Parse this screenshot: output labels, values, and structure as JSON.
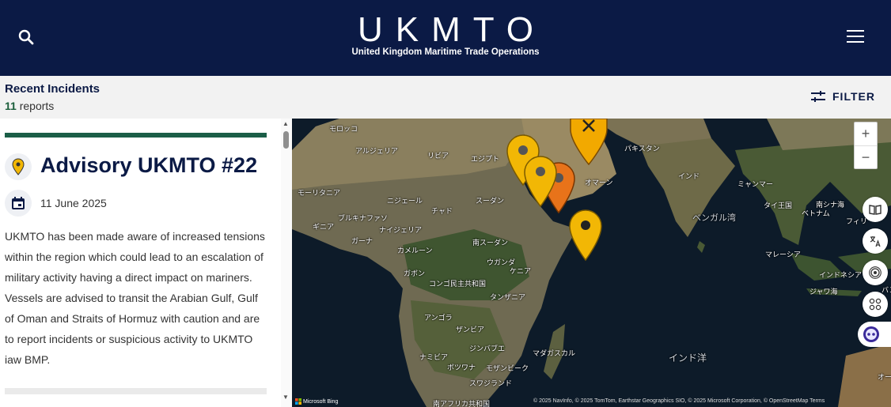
{
  "header": {
    "logo_title": "UKMTO",
    "logo_subtitle": "United Kingdom Maritime Trade Operations",
    "bg_color": "#0b1a45"
  },
  "subbar": {
    "title": "Recent Incidents",
    "count": "11",
    "count_suffix": "reports",
    "filter_label": "FILTER"
  },
  "advisory": {
    "title": "Advisory UKMTO #22",
    "date": "11 June 2025",
    "body": "UKMTO has been made aware of increased tensions within the region which could lead to an escalation of military activity having a direct impact on mariners. Vessels are advised to transit the Arabian Gulf, Gulf of Oman and Straits of Hormuz with caution and are to report incidents or suspicious activity to UKMTO iaw BMP.",
    "accent_color": "#1b5e47"
  },
  "map": {
    "places": [
      {
        "id": "morocco",
        "label": "モロッコ"
      },
      {
        "id": "algeria",
        "label": "アルジェリア"
      },
      {
        "id": "libya",
        "label": "リビア"
      },
      {
        "id": "egypt",
        "label": "エジプト"
      },
      {
        "id": "pakistan",
        "label": "パキスタン"
      },
      {
        "id": "india",
        "label": "インド"
      },
      {
        "id": "myanmar",
        "label": "ミャンマー"
      },
      {
        "id": "mauritania",
        "label": "モーリタニア"
      },
      {
        "id": "niger",
        "label": "ニジェール"
      },
      {
        "id": "chad",
        "label": "チャド"
      },
      {
        "id": "sudan",
        "label": "スーダン"
      },
      {
        "id": "oman",
        "label": "オマーン"
      },
      {
        "id": "thailand",
        "label": "タイ王国"
      },
      {
        "id": "vietnam",
        "label": "ベトナム"
      },
      {
        "id": "south_china_sea",
        "label": "南シナ海"
      },
      {
        "id": "philippines",
        "label": "フィリ"
      },
      {
        "id": "bay_of_bengal",
        "label": "ベンガル湾"
      },
      {
        "id": "burkina",
        "label": "ブルキナファソ"
      },
      {
        "id": "guinea",
        "label": "ギニア"
      },
      {
        "id": "nigeria",
        "label": "ナイジェリア"
      },
      {
        "id": "ghana",
        "label": "ガーナ"
      },
      {
        "id": "south_sudan",
        "label": "南スーダン"
      },
      {
        "id": "cameroon",
        "label": "カメルーン"
      },
      {
        "id": "uganda",
        "label": "ウガンダ"
      },
      {
        "id": "gabon",
        "label": "ガボン"
      },
      {
        "id": "kenya",
        "label": "ケニア"
      },
      {
        "id": "drc",
        "label": "コンゴ民主共和国"
      },
      {
        "id": "malaysia",
        "label": "マレーシア"
      },
      {
        "id": "indonesia",
        "label": "インドネシア"
      },
      {
        "id": "java_sea",
        "label": "ジャワ海"
      },
      {
        "id": "tanzania",
        "label": "タンザニア"
      },
      {
        "id": "angola",
        "label": "アンゴラ"
      },
      {
        "id": "zambia",
        "label": "ザンビア"
      },
      {
        "id": "zimbabwe",
        "label": "ジンバブエ"
      },
      {
        "id": "madagascar",
        "label": "マダガスカル"
      },
      {
        "id": "indian_ocean",
        "label": "インド洋"
      },
      {
        "id": "namibia",
        "label": "ナミビア"
      },
      {
        "id": "botswana",
        "label": "ボツワナ"
      },
      {
        "id": "mozambique",
        "label": "モザンビーク"
      },
      {
        "id": "eswatini",
        "label": "スワジランド"
      },
      {
        "id": "south_africa",
        "label": "南アフリカ共和国"
      },
      {
        "id": "banda",
        "label": "バンダ"
      },
      {
        "id": "oz",
        "label": "オー"
      }
    ],
    "zoom_in": "+",
    "zoom_out": "−",
    "bing_label": "Microsoft Bing",
    "attribution": "© 2025 NavInfo, © 2025 TomTom, Earthstar Geographics SIO, © 2025 Microsoft Corporation, © OpenStreetMap  Terms"
  }
}
